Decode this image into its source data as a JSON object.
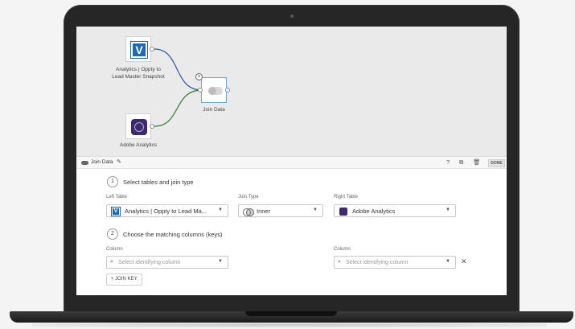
{
  "canvas": {
    "nodes": [
      {
        "label": "Analytics | Oppty to Lead Master Snapshot"
      },
      {
        "label": "Join Data"
      },
      {
        "label": "Adobe Analytics"
      }
    ],
    "link_colors": {
      "top": "#2a5aa0",
      "bottom": "#2f7a2f"
    }
  },
  "toolbar": {
    "title": "Join Data",
    "help_icon": "help-icon",
    "copy_icon": "copy-icon",
    "delete_icon": "trash-icon",
    "done_label": "DONE"
  },
  "step1": {
    "number": "1",
    "text": "Select tables and join type",
    "left_table_label": "Left Table",
    "left_table_value": "Analytics | Oppty to Lead Ma...",
    "join_type_label": "Join Type",
    "join_type_value": "Inner",
    "right_table_label": "Right Table",
    "right_table_value": "Adobe Analytics"
  },
  "step2": {
    "number": "2",
    "text": "Choose the matching columns (keys)",
    "left_column_label": "Column",
    "left_column_placeholder": "Select identifying column",
    "right_column_label": "Column",
    "right_column_placeholder": "Select identifying column",
    "join_key_label": "+ JOIN KEY"
  },
  "colors": {
    "accent": "#1f69b4",
    "adobe": "#3c2a6b"
  }
}
